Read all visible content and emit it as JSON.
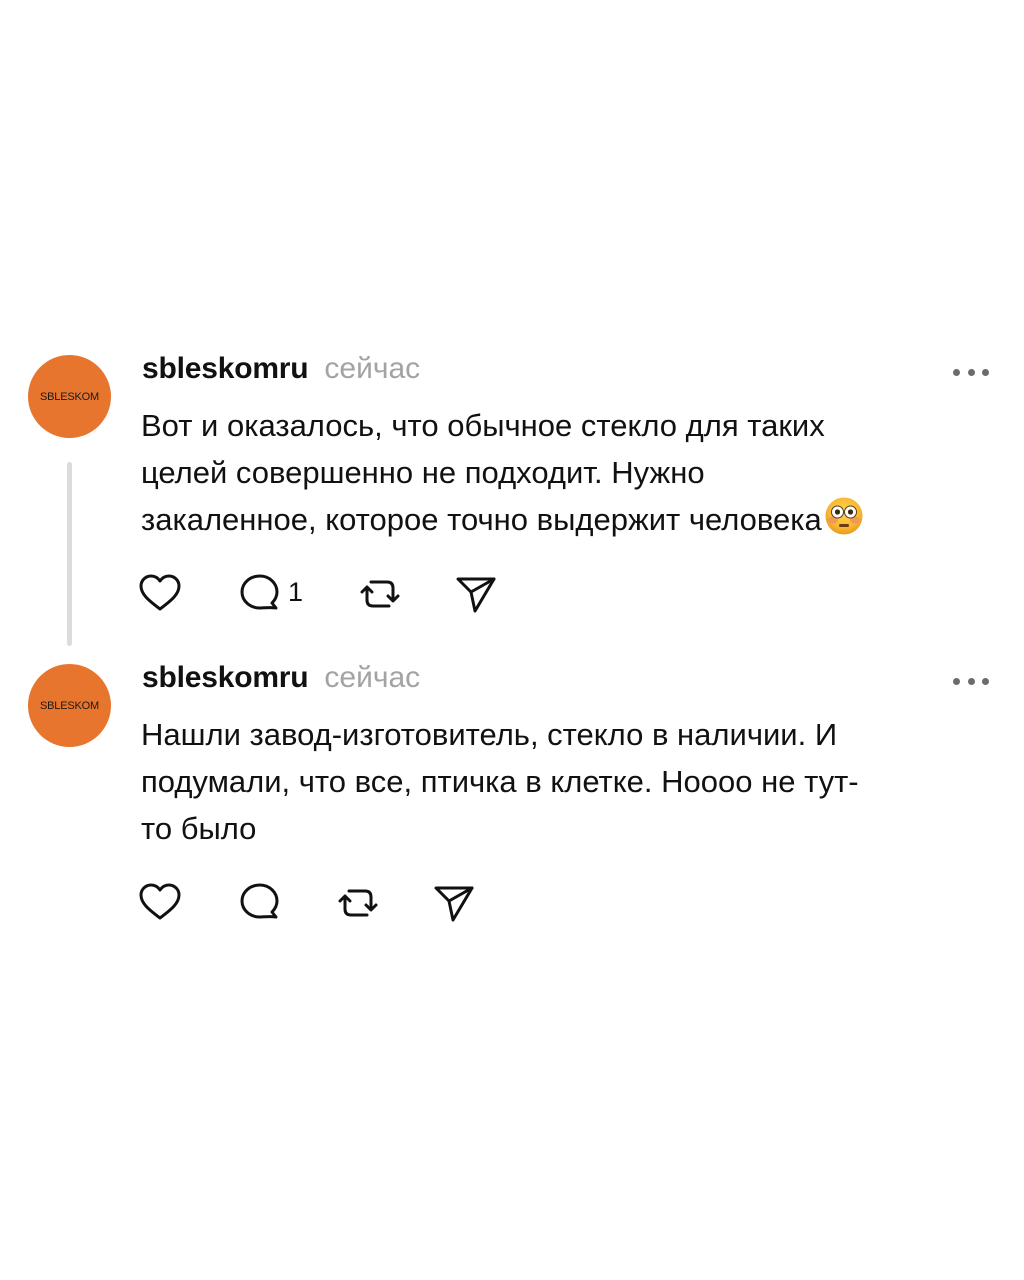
{
  "posts": [
    {
      "avatar_text": "SBLESKOM",
      "username": "sbleskomru",
      "timestamp": "сейчас",
      "text_lines": [
        "Вот и оказалось, что обычное стекло для таких",
        "целей совершенно не подходит. Нужно",
        "закаленное, которое точно выдержит человека"
      ],
      "emoji_icon": "flushed-face-icon",
      "reply_count": "1"
    },
    {
      "avatar_text": "SBLESKOM",
      "username": "sbleskomru",
      "timestamp": "сейчас",
      "text_lines": [
        "Нашли завод-изготовитель, стекло в наличии. И",
        "подумали, что все, птичка в клетке. Нoooo не тут-",
        "то было"
      ]
    }
  ],
  "colors": {
    "avatar_bg": "#e8752d",
    "timestamp": "#a3a3a3",
    "thread_line": "#dcdcdc",
    "text": "#111111"
  },
  "icons": [
    "heart-icon",
    "comment-icon",
    "repost-icon",
    "share-icon",
    "more-icon"
  ]
}
